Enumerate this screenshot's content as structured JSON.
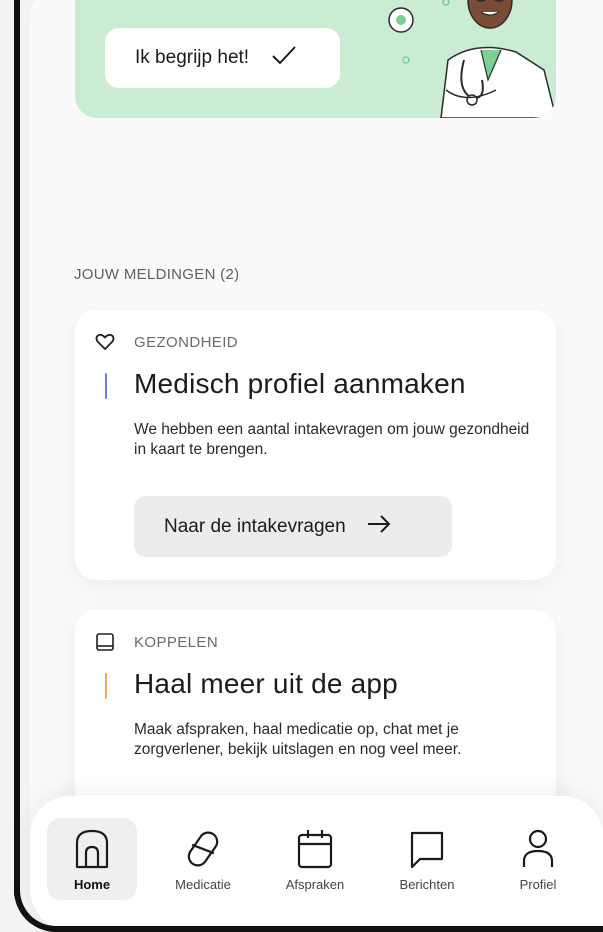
{
  "banner": {
    "button_label": "Ik begrijp het!",
    "button_icon": "check-icon",
    "background": "#c9ecd2"
  },
  "notifications": {
    "section_title": "JOUW MELDINGEN (2)",
    "cards": [
      {
        "category": "GEZONDHEID",
        "category_icon": "heart-icon",
        "accent_color": "#6b7fd6",
        "title": "Medisch profiel aanmaken",
        "description": "We hebben een aantal intakevragen om jouw gezondheid in kaart te brengen.",
        "action_label": "Naar de intakevragen",
        "action_icon": "arrow-right-icon"
      },
      {
        "category": "KOPPELEN",
        "category_icon": "book-icon",
        "accent_color": "#f0a85a",
        "title": "Haal meer uit de app",
        "description": "Maak afspraken, haal medicatie op, chat met je zorgverlener, bekijk uitslagen en nog veel meer."
      }
    ]
  },
  "bottom_nav": {
    "active": "Home",
    "items": [
      {
        "label": "Home",
        "icon": "home-icon"
      },
      {
        "label": "Medicatie",
        "icon": "pill-icon"
      },
      {
        "label": "Afspraken",
        "icon": "calendar-icon"
      },
      {
        "label": "Berichten",
        "icon": "message-icon"
      },
      {
        "label": "Profiel",
        "icon": "user-icon"
      }
    ]
  }
}
